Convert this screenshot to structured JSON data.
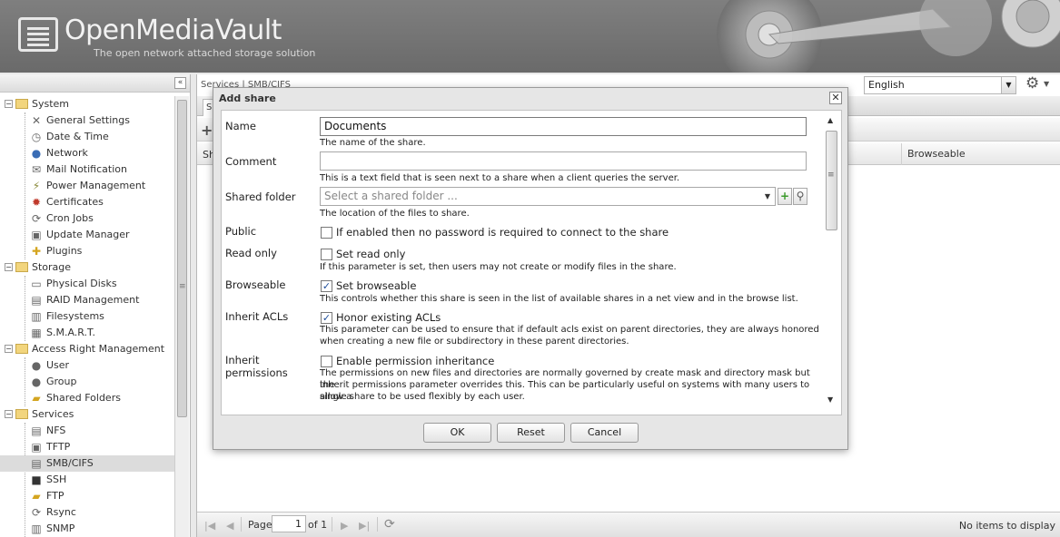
{
  "app": {
    "title": "OpenMediaVault",
    "subtitle": "The open network attached storage solution"
  },
  "sidebar": {
    "categories": [
      {
        "label": "System",
        "items": [
          {
            "label": "General Settings",
            "icon": "tools-icon"
          },
          {
            "label": "Date & Time",
            "icon": "clock-icon"
          },
          {
            "label": "Network",
            "icon": "globe-icon"
          },
          {
            "label": "Mail Notification",
            "icon": "mail-icon"
          },
          {
            "label": "Power Management",
            "icon": "power-icon"
          },
          {
            "label": "Certificates",
            "icon": "certificate-icon"
          },
          {
            "label": "Cron Jobs",
            "icon": "cron-icon"
          },
          {
            "label": "Update Manager",
            "icon": "update-icon"
          },
          {
            "label": "Plugins",
            "icon": "puzzle-icon"
          }
        ]
      },
      {
        "label": "Storage",
        "items": [
          {
            "label": "Physical Disks",
            "icon": "disk-icon"
          },
          {
            "label": "RAID Management",
            "icon": "raid-icon"
          },
          {
            "label": "Filesystems",
            "icon": "filesystem-icon"
          },
          {
            "label": "S.M.A.R.T.",
            "icon": "smart-icon"
          }
        ]
      },
      {
        "label": "Access Right Management",
        "items": [
          {
            "label": "User",
            "icon": "user-icon"
          },
          {
            "label": "Group",
            "icon": "group-icon"
          },
          {
            "label": "Shared Folders",
            "icon": "shared-folder-icon"
          }
        ]
      },
      {
        "label": "Services",
        "items": [
          {
            "label": "NFS",
            "icon": "nfs-icon"
          },
          {
            "label": "TFTP",
            "icon": "tftp-icon"
          },
          {
            "label": "SMB/CIFS",
            "icon": "smb-icon",
            "selected": true
          },
          {
            "label": "SSH",
            "icon": "terminal-icon"
          },
          {
            "label": "FTP",
            "icon": "ftp-icon"
          },
          {
            "label": "Rsync",
            "icon": "rsync-icon"
          },
          {
            "label": "SNMP",
            "icon": "snmp-icon"
          }
        ]
      }
    ]
  },
  "main": {
    "breadcrumb": "Services | SMB/CIFS",
    "language": "English",
    "tab_stub": "S",
    "grid": {
      "col_first_stub": "Sh",
      "col_browseable": "Browseable"
    },
    "pager": {
      "page_label": "Page",
      "page_value": "1",
      "of_label": "of 1",
      "empty_text": "No items to display"
    }
  },
  "dialog": {
    "title": "Add share",
    "fields": {
      "name": {
        "label": "Name",
        "value": "Documents",
        "help": "The name of the share."
      },
      "comment": {
        "label": "Comment",
        "value": "",
        "help": "This is a text field that is seen next to a share when a client queries the server."
      },
      "shared_folder": {
        "label": "Shared folder",
        "placeholder": "Select a shared folder ...",
        "help": "The location of the files to share."
      },
      "public": {
        "label": "Public",
        "checked": false,
        "box_label": "If enabled then no password is required to connect to the share"
      },
      "read_only": {
        "label": "Read only",
        "checked": false,
        "box_label": "Set read only",
        "help": "If this parameter is set, then users may not create or modify files in the share."
      },
      "browseable": {
        "label": "Browseable",
        "checked": true,
        "box_label": "Set browseable",
        "help": "This controls whether this share is seen in the list of available shares in a net view and in the browse list."
      },
      "inherit_acls": {
        "label": "Inherit ACLs",
        "checked": true,
        "box_label": "Honor existing ACLs",
        "help_line1": "This parameter can be used to ensure that if default acls exist on parent directories, they are always honored",
        "help_line2": "when creating a new file or subdirectory in these parent directories."
      },
      "inherit_perms": {
        "label_line1": "Inherit",
        "label_line2": "permissions",
        "checked": false,
        "box_label": "Enable permission inheritance",
        "help_line1": "The permissions on new files and directories are normally governed by create mask and directory mask but the",
        "help_line2": "inherit permissions parameter overrides this. This can be particularly useful on systems with many users to allow a",
        "help_line3": "single share to be used flexibly by each user."
      }
    },
    "buttons": {
      "ok": "OK",
      "reset": "Reset",
      "cancel": "Cancel"
    }
  },
  "colors": {
    "header_bg": "#737373",
    "check_mark": "#1e4d9a",
    "selected_row": "#dcdcdc"
  }
}
